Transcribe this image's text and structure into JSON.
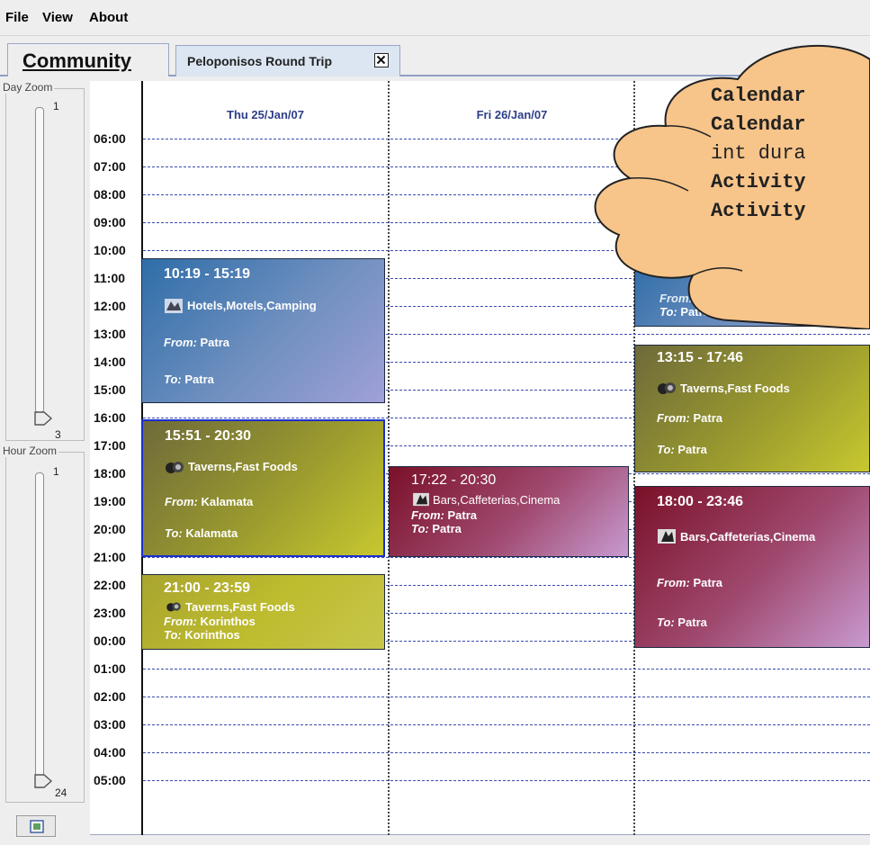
{
  "menu": {
    "file": "File",
    "view": "View",
    "about": "About"
  },
  "tabs": {
    "community": "Community",
    "trip": "Peloponisos Round Trip"
  },
  "zoom": {
    "day_label": "Day Zoom",
    "day_min": "1",
    "day_max": "3",
    "day_value": 3,
    "hour_label": "Hour Zoom",
    "hour_min": "1",
    "hour_max": "24",
    "hour_value": 24
  },
  "calendar": {
    "days": [
      "Thu 25/Jan/07",
      "Fri 26/Jan/07"
    ],
    "hours": [
      "06:00",
      "07:00",
      "08:00",
      "09:00",
      "10:00",
      "11:00",
      "12:00",
      "13:00",
      "14:00",
      "15:00",
      "16:00",
      "17:00",
      "18:00",
      "19:00",
      "20:00",
      "21:00",
      "22:00",
      "23:00",
      "00:00",
      "01:00",
      "02:00",
      "03:00",
      "04:00",
      "05:00"
    ]
  },
  "activities": {
    "a1": {
      "time": "10:19 - 15:19",
      "category": "Hotels,Motels,Camping",
      "from_label": "From:",
      "from": "Patra",
      "to_label": "To:",
      "to": "Patra",
      "icon": "hotel-icon",
      "color": "#3a70aa"
    },
    "a2": {
      "time": "15:51 - 20:30",
      "category": "Taverns,Fast Foods",
      "from_label": "From:",
      "from": "Kalamata",
      "to_label": "To:",
      "to": "Kalamata",
      "icon": "tavern-icon",
      "color": "#8a8830"
    },
    "a3": {
      "time": "21:00 - 23:59",
      "category": "Taverns,Fast Foods",
      "from_label": "From:",
      "from": "Korinthos",
      "to_label": "To:",
      "to": "Korinthos",
      "icon": "tavern-icon",
      "color": "#b8b530"
    },
    "a4": {
      "time": "17:22 - 20:30",
      "category": "Bars,Caffeterias,Cinema",
      "from_label": "From:",
      "from": "Patra",
      "to_label": "To:",
      "to": "Patra",
      "icon": "bar-icon",
      "color": "#8a2040"
    },
    "a5": {
      "from_label": "From:",
      "to_label": "To:",
      "to": "Patra",
      "color": "#3a70aa"
    },
    "a6": {
      "time": "13:15 - 17:46",
      "category": "Taverns,Fast Foods",
      "from_label": "From:",
      "from": "Patra",
      "to_label": "To:",
      "to": "Patra",
      "icon": "tavern-icon",
      "color": "#8a8830"
    },
    "a7": {
      "time": "18:00 - 23:46",
      "category": "Bars,Caffeterias,Cinema",
      "from_label": "From:",
      "from": "Patra",
      "to_label": "To:",
      "to": "Patra",
      "icon": "bar-icon",
      "color": "#8a2040"
    }
  },
  "callout": {
    "lines": [
      "Calendar",
      "Calendar",
      "int dura",
      "Activity",
      "Activity"
    ],
    "fill": "#f7c48a"
  }
}
